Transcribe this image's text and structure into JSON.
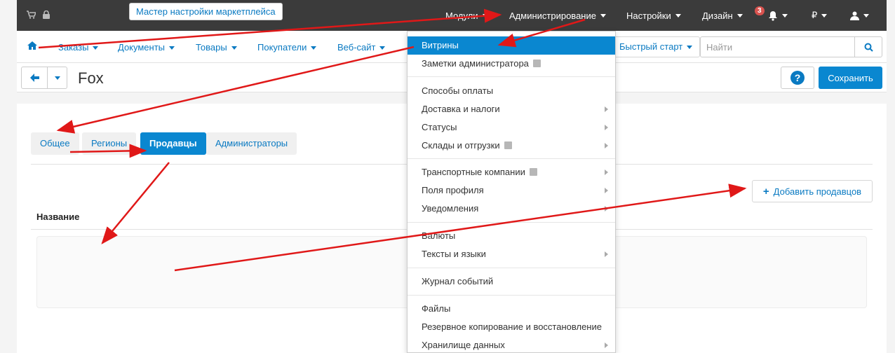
{
  "topbar": {
    "wizard_tip": "Мастер настройки маркетплейса",
    "nav": [
      "Модули",
      "Администрирование",
      "Настройки",
      "Дизайн"
    ],
    "notification_count": "3",
    "currency": "₽"
  },
  "subnav": {
    "items": [
      "Заказы",
      "Документы",
      "Товары",
      "Покупатели",
      "Веб-сайт"
    ],
    "quick_start": "Быстрый старт",
    "search_placeholder": "Найти"
  },
  "title_bar": {
    "title": "Fox",
    "save_label": "Сохранить"
  },
  "tabs": [
    "Общее",
    "Регионы",
    "Продавцы",
    "Администраторы"
  ],
  "active_tab": "Продавцы",
  "add_button": "Добавить продавцов",
  "table": {
    "column_header": "Название"
  },
  "admin_menu": {
    "items": [
      "Витрины",
      "Заметки администратора",
      "Способы оплаты",
      "Доставка и налоги",
      "Статусы",
      "Склады и отгрузки",
      "Транспортные компании",
      "Поля профиля",
      "Уведомления",
      "Валюты",
      "Тексты и языки",
      "Журнал событий",
      "Файлы",
      "Резервное копирование и восстановление",
      "Хранилище данных"
    ]
  },
  "colors": {
    "accent": "#0a87d0",
    "link": "#0a7ac2",
    "topbar": "#3b3b3b",
    "annotation_arrow": "#e01818",
    "badge": "#d9534f"
  }
}
